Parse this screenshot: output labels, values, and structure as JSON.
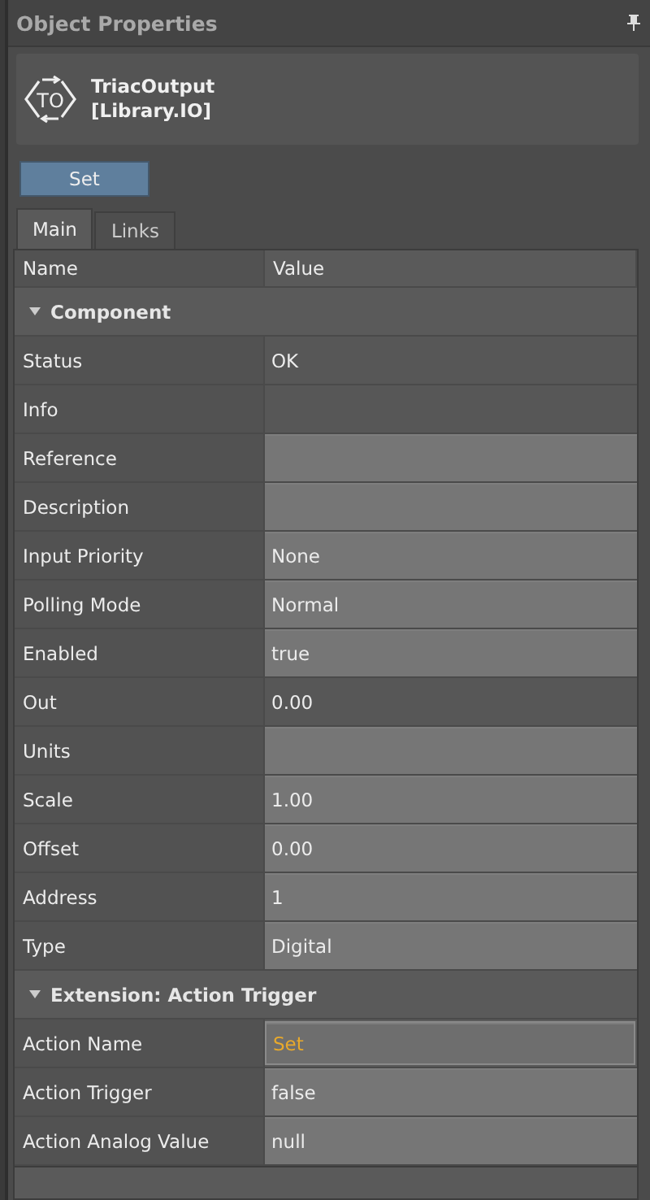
{
  "panel": {
    "title": "Object Properties"
  },
  "object": {
    "icon_text": "TO",
    "name": "TriacOutput",
    "library": "[Library.IO]"
  },
  "action_button": "Set",
  "tabs": [
    {
      "label": "Main",
      "selected": true
    },
    {
      "label": "Links",
      "selected": false
    }
  ],
  "table": {
    "columns": [
      "Name",
      "Value"
    ],
    "groups": [
      {
        "title": "Component",
        "expanded": true,
        "rows": [
          {
            "name": "Status",
            "value": "OK",
            "editable": false,
            "focused": false
          },
          {
            "name": "Info",
            "value": "",
            "editable": false,
            "focused": false
          },
          {
            "name": "Reference",
            "value": "",
            "editable": true,
            "focused": false
          },
          {
            "name": "Description",
            "value": "",
            "editable": true,
            "focused": false
          },
          {
            "name": "Input Priority",
            "value": "None",
            "editable": true,
            "focused": false
          },
          {
            "name": "Polling Mode",
            "value": "Normal",
            "editable": true,
            "focused": false
          },
          {
            "name": "Enabled",
            "value": "true",
            "editable": true,
            "focused": false
          },
          {
            "name": "Out",
            "value": "0.00",
            "editable": false,
            "focused": false
          },
          {
            "name": "Units",
            "value": "",
            "editable": true,
            "focused": false
          },
          {
            "name": "Scale",
            "value": "1.00",
            "editable": true,
            "focused": false
          },
          {
            "name": "Offset",
            "value": "0.00",
            "editable": true,
            "focused": false
          },
          {
            "name": "Address",
            "value": "1",
            "editable": true,
            "focused": false
          },
          {
            "name": "Type",
            "value": "Digital",
            "editable": true,
            "focused": false
          }
        ]
      },
      {
        "title": "Extension: Action Trigger",
        "expanded": true,
        "rows": [
          {
            "name": "Action Name",
            "value": "Set",
            "editable": true,
            "focused": true
          },
          {
            "name": "Action Trigger",
            "value": "false",
            "editable": true,
            "focused": false
          },
          {
            "name": "Action Analog Value",
            "value": "null",
            "editable": true,
            "focused": false
          }
        ]
      }
    ]
  }
}
